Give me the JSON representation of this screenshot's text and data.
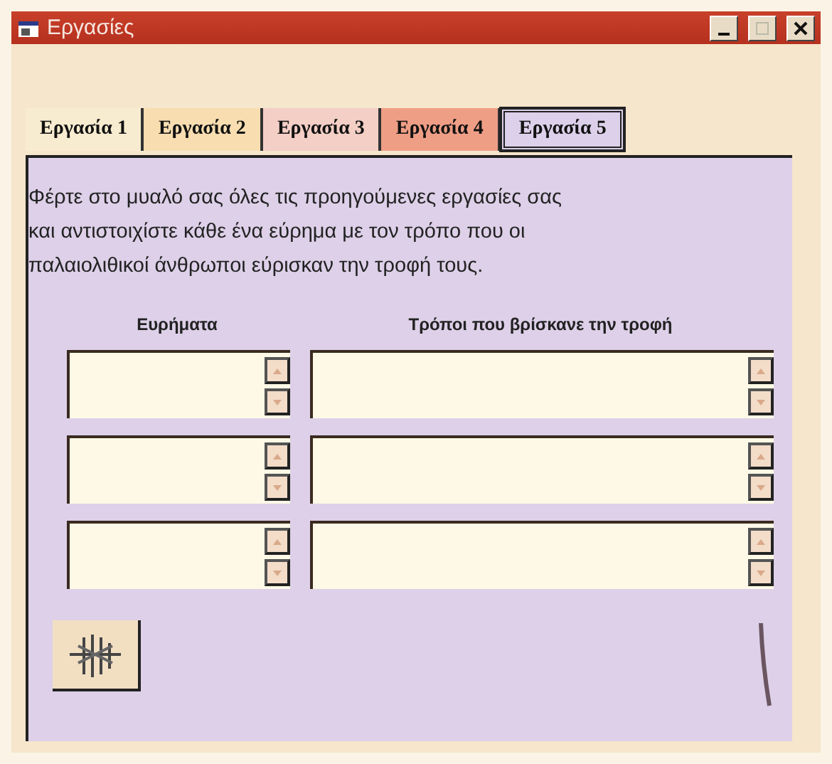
{
  "window": {
    "title": "Εργασίες"
  },
  "tabs": [
    {
      "label": "Εργασία 1",
      "selected": false,
      "color": "#f8ecd0"
    },
    {
      "label": "Εργασία 2",
      "selected": false,
      "color": "#f7ddb0"
    },
    {
      "label": "Εργασία 3",
      "selected": false,
      "color": "#f4cfc6"
    },
    {
      "label": "Εργασία 4",
      "selected": false,
      "color": "#ef9e86"
    },
    {
      "label": "Εργασία 5",
      "selected": true,
      "color": "#dcd0ea"
    }
  ],
  "instructions": [
    "Φέρτε στο μυαλό σας όλες τις προηγούμενες εργασίες σας",
    "και αντιστοιχίστε κάθε ένα εύρημα με τον τρόπο που οι",
    "παλαιολιθικοί άνθρωποι εύρισκαν την τροφή τους."
  ],
  "columns": [
    "Ευρήματα",
    "Τρόποι που βρίσκανε την τροφή"
  ],
  "rows": [
    {
      "finding": {
        "kind": "textarea"
      },
      "method": {
        "kind": "textarea"
      }
    },
    {
      "finding": {
        "kind": "textarea"
      },
      "method": {
        "kind": "textarea"
      }
    },
    {
      "finding": {
        "kind": "textarea"
      },
      "method": {
        "kind": "textarea"
      }
    }
  ]
}
